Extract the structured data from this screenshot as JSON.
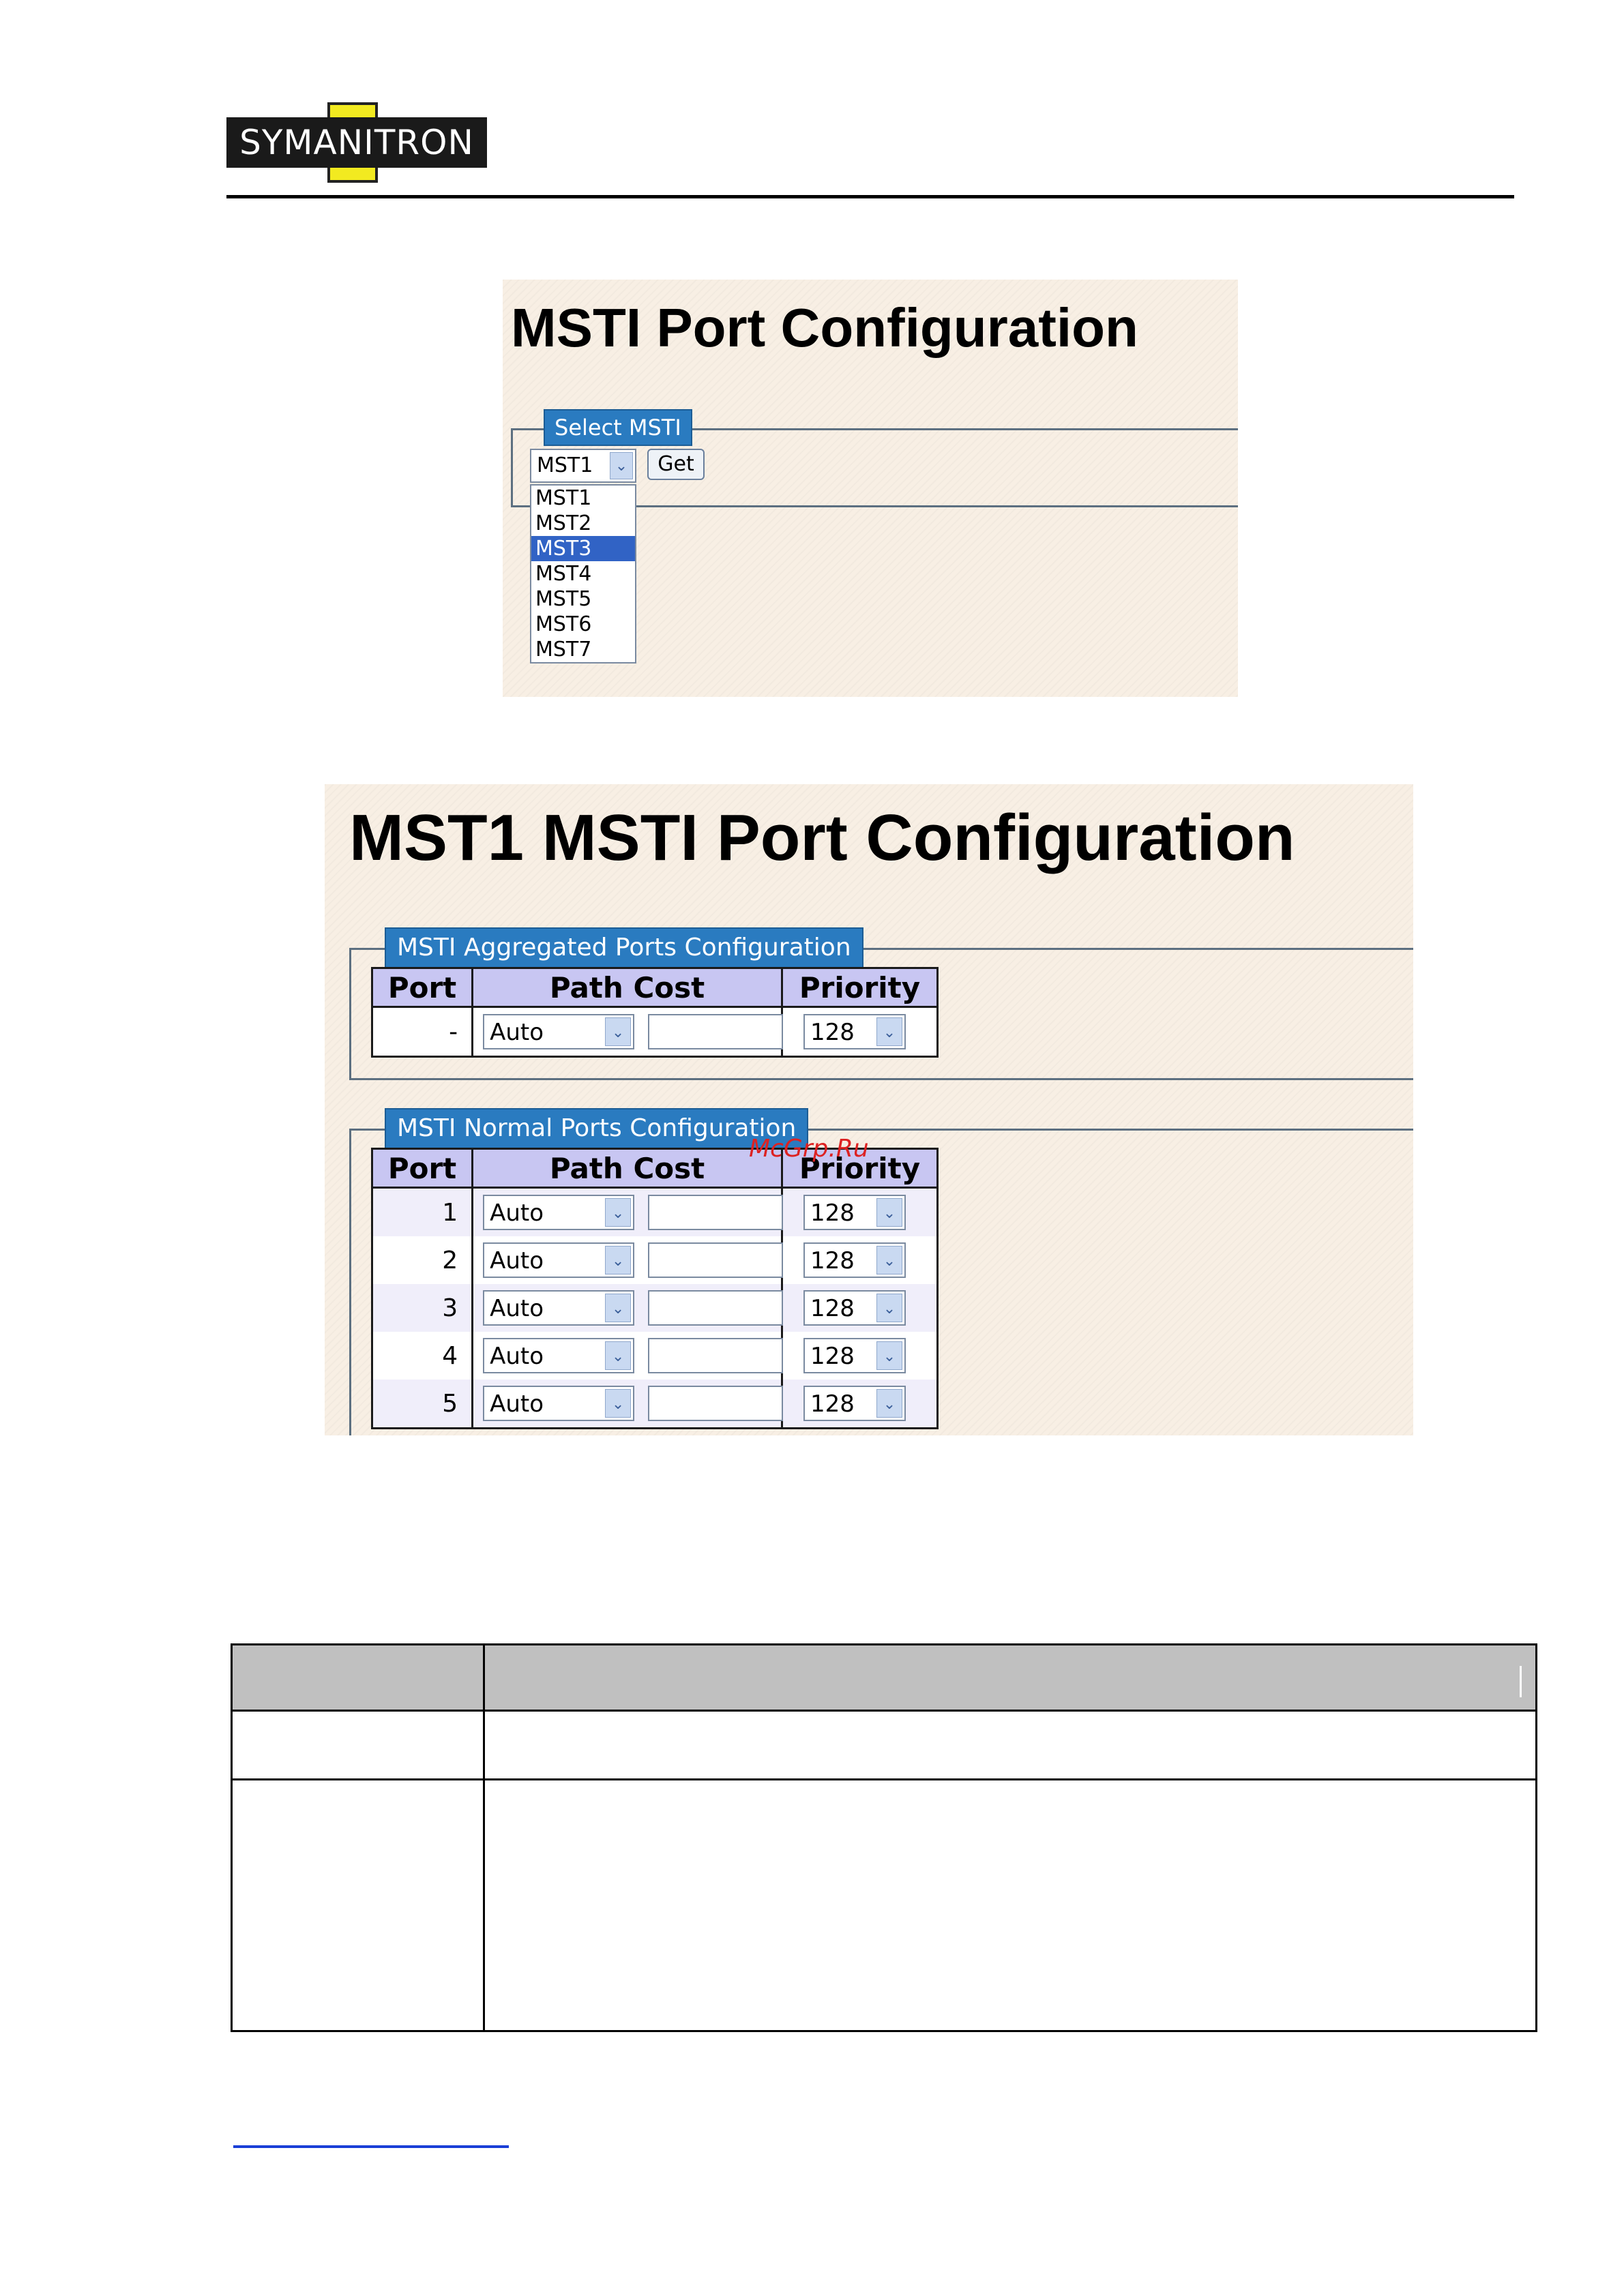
{
  "logo": {
    "text": "SYMANITRON"
  },
  "screenshot1": {
    "title": "MSTI Port Configuration",
    "legend": "Select MSTI",
    "select_value": "MST1",
    "get_button": "Get",
    "options": [
      "MST1",
      "MST2",
      "MST3",
      "MST4",
      "MST5",
      "MST6",
      "MST7"
    ],
    "highlighted_option": "MST3"
  },
  "screenshot2": {
    "title": "MST1 MSTI Port Configuration",
    "aggregated": {
      "legend": "MSTI Aggregated Ports Configuration",
      "headers": {
        "port": "Port",
        "path_cost": "Path Cost",
        "priority": "Priority"
      },
      "rows": [
        {
          "port": "-",
          "path_cost": "Auto",
          "priority": "128"
        }
      ]
    },
    "normal": {
      "legend": "MSTI Normal Ports Configuration",
      "headers": {
        "port": "Port",
        "path_cost": "Path Cost",
        "priority": "Priority"
      },
      "rows": [
        {
          "port": "1",
          "path_cost": "Auto",
          "priority": "128"
        },
        {
          "port": "2",
          "path_cost": "Auto",
          "priority": "128"
        },
        {
          "port": "3",
          "path_cost": "Auto",
          "priority": "128"
        },
        {
          "port": "4",
          "path_cost": "Auto",
          "priority": "128"
        },
        {
          "port": "5",
          "path_cost": "Auto",
          "priority": "128"
        }
      ]
    }
  },
  "watermark": "McGrp.Ru",
  "colors": {
    "legend_bg": "#2a7bc0",
    "header_bg": "#c8c6f2",
    "panel_bg": "#f8efe4",
    "selected_option": "#3163c5"
  }
}
